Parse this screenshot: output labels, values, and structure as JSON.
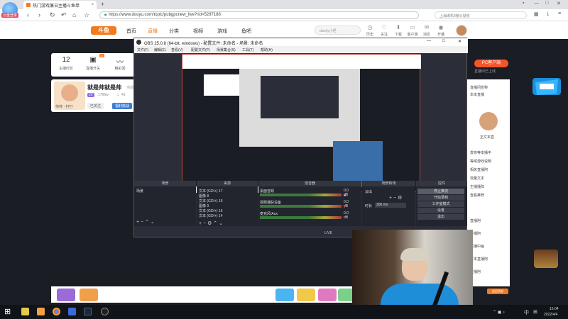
{
  "browser": {
    "brand_label": "云盘登录",
    "tab_title": "热门游戏兼日主播斗鱼单",
    "tab_close": "×",
    "new_tab": "+",
    "url": "https://www.douyu.com/topic/pubgpcnew_live?rid=5297188",
    "right_search": "上海爆机8棚头疑枚",
    "win_controls": [
      "—",
      "□",
      "✕"
    ],
    "nav_icons": [
      "back-icon",
      "forward-icon",
      "refresh-icon",
      "undo-icon",
      "home-icon",
      "star-icon"
    ]
  },
  "douyu": {
    "logo": "斗鱼",
    "nav": [
      "首页",
      "直播",
      "分类",
      "视频",
      "游戏",
      "鱼吧"
    ],
    "active_nav": "直播",
    "search_placeholder": "dandy小怪",
    "header_icons": [
      {
        "name": "history",
        "label": "历史"
      },
      {
        "name": "follow",
        "label": "关注"
      },
      {
        "name": "message",
        "label": "下载"
      },
      {
        "name": "client",
        "label": "客户端"
      },
      {
        "name": "mail",
        "label": "消息"
      },
      {
        "name": "broadcast",
        "label": "开播"
      }
    ],
    "stats": [
      {
        "value": "12",
        "label": "主播时长"
      },
      {
        "value": "",
        "label": "直播开关"
      },
      {
        "value": "",
        "label": "精彩回"
      }
    ],
    "hot_badge": "8",
    "streamer_name": "就是帅就是帅",
    "streamer_suffix": "当前",
    "streamer_level": "LV",
    "streamer_fans": "1766w",
    "streamer_heat": "41",
    "avatar_caption": "帅帅 · 打打",
    "follow_btn": "已关注",
    "share_btn": "福利挑战",
    "pc_client": "PC客户端",
    "pc_sub": "直播间已上线",
    "right_lines": [
      "直播间宣称",
      "本本直播",
      "正文本直",
      "发布等本播中",
      "等候游戏说明",
      "相关直播阿",
      "流量文本",
      "主播播阵",
      "查看推荐"
    ],
    "right_lines_b": [
      "直播阿",
      "主播阿",
      "直播中画",
      "本本直播阿",
      "直播阿",
      "查看互动"
    ],
    "cam_jump": "返回顶部"
  },
  "obs": {
    "title": "OBS 25.0.8 (64-bit, windows) - 配置文件: 未命名 - 场景: 未命名",
    "menu": [
      "文件(F)",
      "编辑(E)",
      "查看(V)",
      "配置文件(P)",
      "场景集合(S)",
      "工具(T)",
      "帮助(H)"
    ],
    "panels": {
      "scenes": "场景",
      "sources": "来源",
      "mixer": "混音器",
      "transitions": "场景转场",
      "controls": "控件"
    },
    "scene_items": [
      "场景"
    ],
    "source_items": [
      "文本 (GDI+) 17",
      "图像 8",
      "文本 (GDI+) 16",
      "图像 9",
      "文本 (GDI+) 15",
      "文本 (GDI+) 14"
    ],
    "mixer_items": [
      {
        "name": "桌面音频",
        "db": "0.0 dB"
      },
      {
        "name": "视频捕获设备",
        "db": "0.0 dB"
      },
      {
        "name": "麦克风/Aux",
        "db": "0.0 dB"
      }
    ],
    "transition": "淡出",
    "duration_label": "时长",
    "duration": "300 ms",
    "controls": [
      "停止推流",
      "开始录制",
      "工作室模式",
      "设置",
      "退出"
    ],
    "status": "LIVE"
  },
  "taskbar": {
    "lang": "中",
    "time": "15:04",
    "date": "2022/4/4"
  }
}
